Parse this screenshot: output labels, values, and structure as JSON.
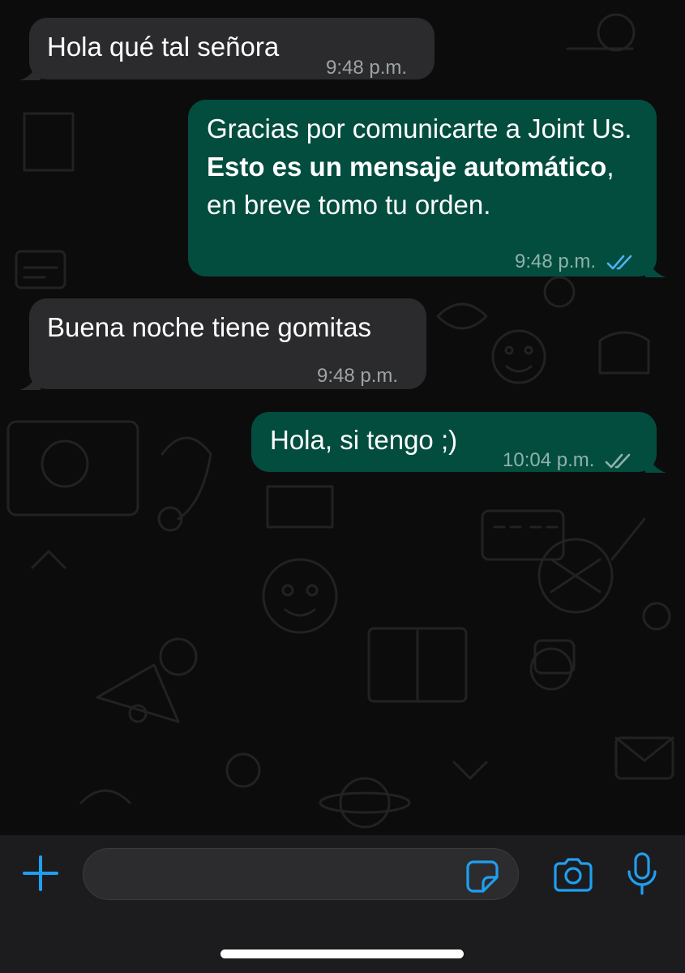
{
  "messages": [
    {
      "direction": "incoming",
      "text": "Hola qué tal señora",
      "time": "9:48 p.m."
    },
    {
      "direction": "outgoing",
      "text_part1": "Gracias por comunicarte a Joint Us. ",
      "text_bold": "Esto es un mensaje automático",
      "text_part2": ", en breve tomo tu orden.",
      "time": "9:48 p.m.",
      "status": "read"
    },
    {
      "direction": "incoming",
      "text": "Buena noche tiene gomitas",
      "time": "9:48 p.m."
    },
    {
      "direction": "outgoing",
      "text": "Hola, si tengo ;)",
      "time": "10:04 p.m.",
      "status": "delivered"
    }
  ],
  "input": {
    "value": "",
    "placeholder": ""
  },
  "icons": {
    "attach": "plus-icon",
    "sticker": "sticker-icon",
    "camera": "camera-icon",
    "mic": "microphone-icon",
    "read_receipt": "double-check-icon"
  },
  "colors": {
    "incoming_bubble": "#2b2b2d",
    "outgoing_bubble": "#034d3f",
    "accent": "#1f9ff0",
    "read_ticks": "#50b2f2",
    "delivered_ticks": "#8fb2aa"
  }
}
